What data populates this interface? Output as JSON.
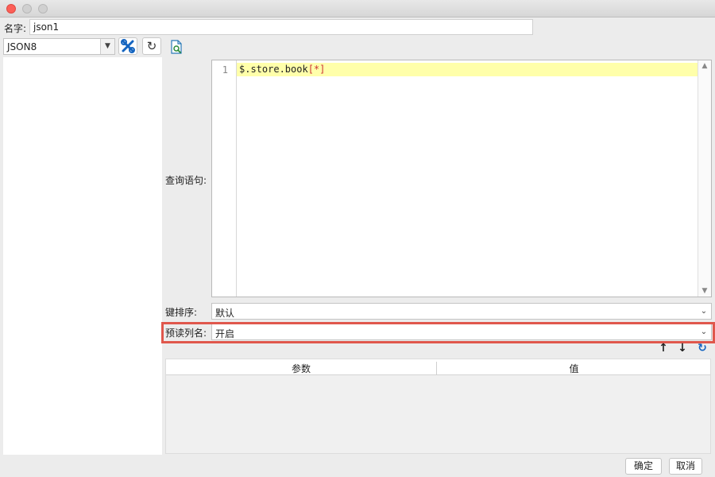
{
  "window": {
    "title": ""
  },
  "name": {
    "label": "名字:",
    "value": "json1"
  },
  "toolbar": {
    "source_selected": "JSON8",
    "tools_icon": "tools-icon",
    "refresh_icon": "refresh-icon",
    "preview_icon": "document-search-icon"
  },
  "query": {
    "label": "查询语句:",
    "line_number": "1",
    "code_text": "$.store.book",
    "code_bracket": "[*]"
  },
  "key_sort": {
    "label": "键排序:",
    "value": "默认"
  },
  "preread": {
    "label": "预读列名:",
    "value": "开启"
  },
  "param_tools": {
    "up_icon": "arrow-up-icon",
    "down_icon": "arrow-down-icon",
    "refresh_icon": "refresh-icon"
  },
  "params_table": {
    "columns": [
      "参数",
      "值"
    ],
    "rows": []
  },
  "buttons": {
    "ok": "确定",
    "cancel": "取消"
  },
  "colors": {
    "highlight": "#e0574c",
    "current_line": "#ffffaa",
    "tool_blue": "#1565c0"
  }
}
